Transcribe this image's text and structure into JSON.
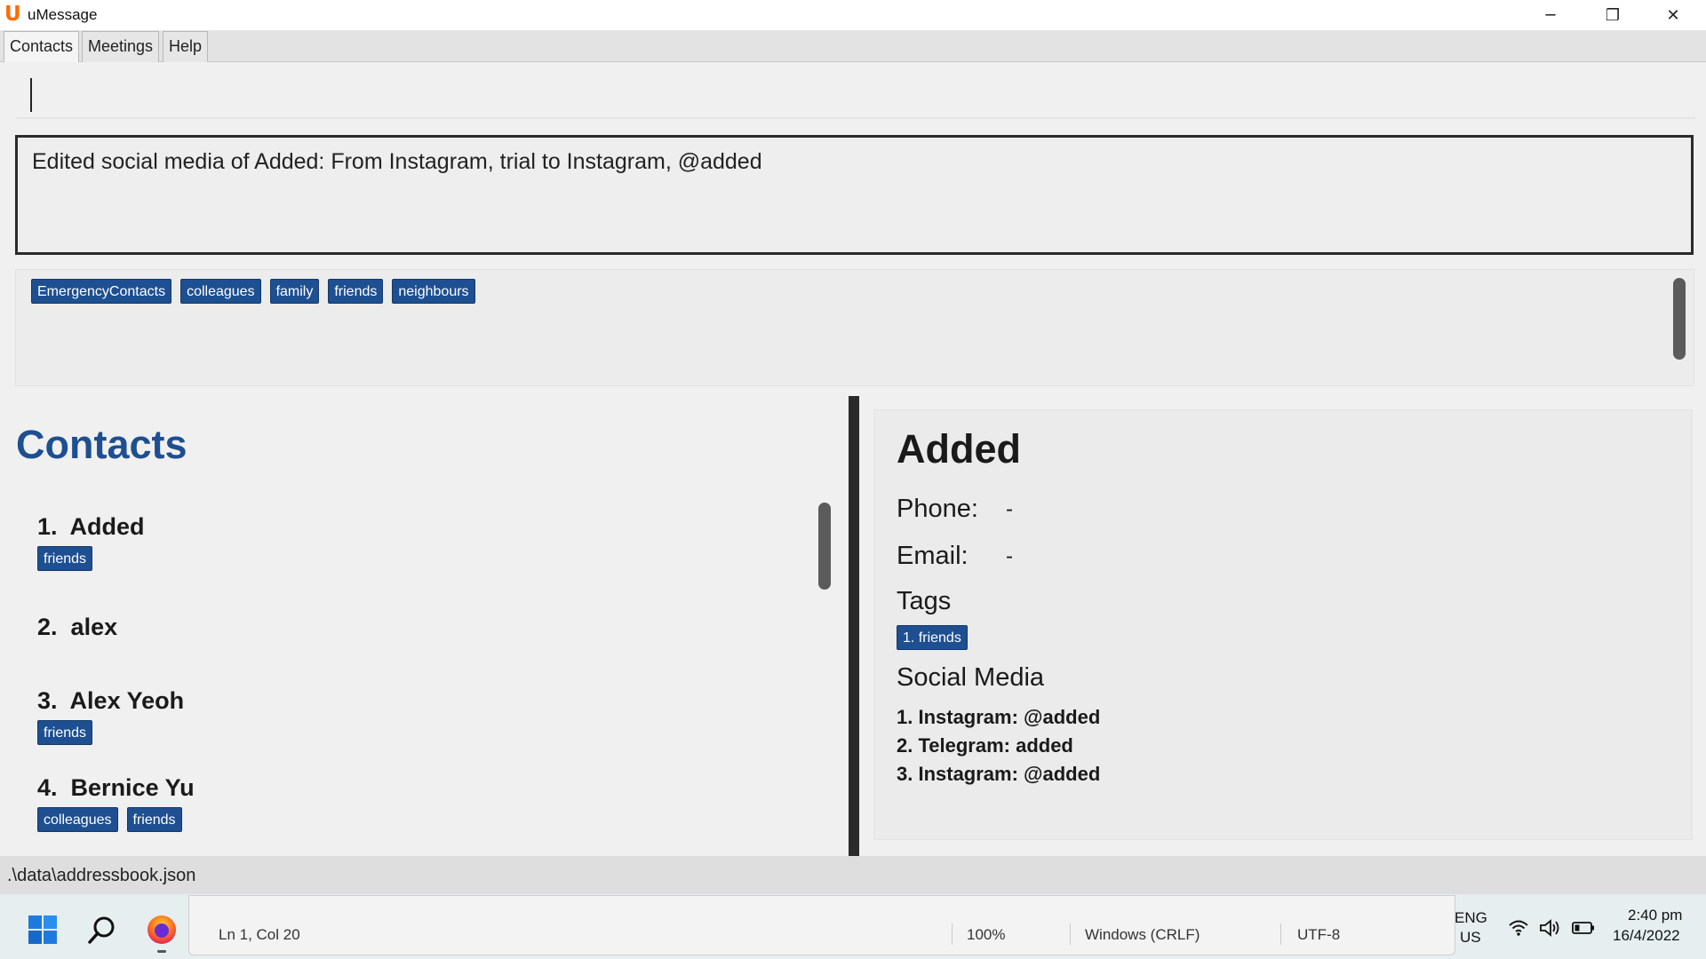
{
  "window": {
    "app_title": "uMessage",
    "app_logo": "U",
    "minimize_glyph": "─",
    "maximize_glyph": "❐",
    "close_glyph": "✕"
  },
  "menu": {
    "items": [
      "Contacts",
      "Meetings",
      "Help"
    ]
  },
  "command_box": {
    "value": ""
  },
  "result": {
    "message": "Edited social media of Added: From Instagram, trial to Instagram, @added"
  },
  "tag_filter": {
    "tags": [
      "EmergencyContacts",
      "colleagues",
      "family",
      "friends",
      "neighbours"
    ]
  },
  "contacts": {
    "title": "Contacts",
    "items": [
      {
        "index": "1.",
        "name": "Added",
        "tags": [
          "friends"
        ]
      },
      {
        "index": "2.",
        "name": "alex",
        "tags": []
      },
      {
        "index": "3.",
        "name": "Alex Yeoh",
        "tags": [
          "friends"
        ]
      },
      {
        "index": "4.",
        "name": "Bernice Yu",
        "tags": [
          "colleagues",
          "friends"
        ]
      }
    ]
  },
  "detail": {
    "name": "Added",
    "phone_label": "Phone:",
    "phone_value": "-",
    "email_label": "Email:",
    "email_value": "-",
    "tags_label": "Tags",
    "tags": [
      "1. friends"
    ],
    "social_label": "Social Media",
    "social": [
      "1. Instagram: @added",
      "2. Telegram: added",
      "3. Instagram: @added"
    ]
  },
  "status": {
    "file_path": ".\\data\\addressbook.json"
  },
  "notepad": {
    "position": "Ln 1, Col 20",
    "zoom": "100%",
    "line_ending": "Windows (CRLF)",
    "encoding": "UTF-8"
  },
  "taskbar": {
    "icons": [
      "windows-start-icon",
      "search-icon",
      "firefox-icon",
      "wifi-icon",
      "volume-icon",
      "battery-icon"
    ],
    "lang_line1": "ENG",
    "lang_line2": "US",
    "time": "2:40 pm",
    "date": "16/4/2022"
  },
  "colors": {
    "accent": "#1d4f91",
    "tag_bg": "#1d4f91",
    "border_dark": "#2b2b2b",
    "logo": "#ff6a00"
  }
}
